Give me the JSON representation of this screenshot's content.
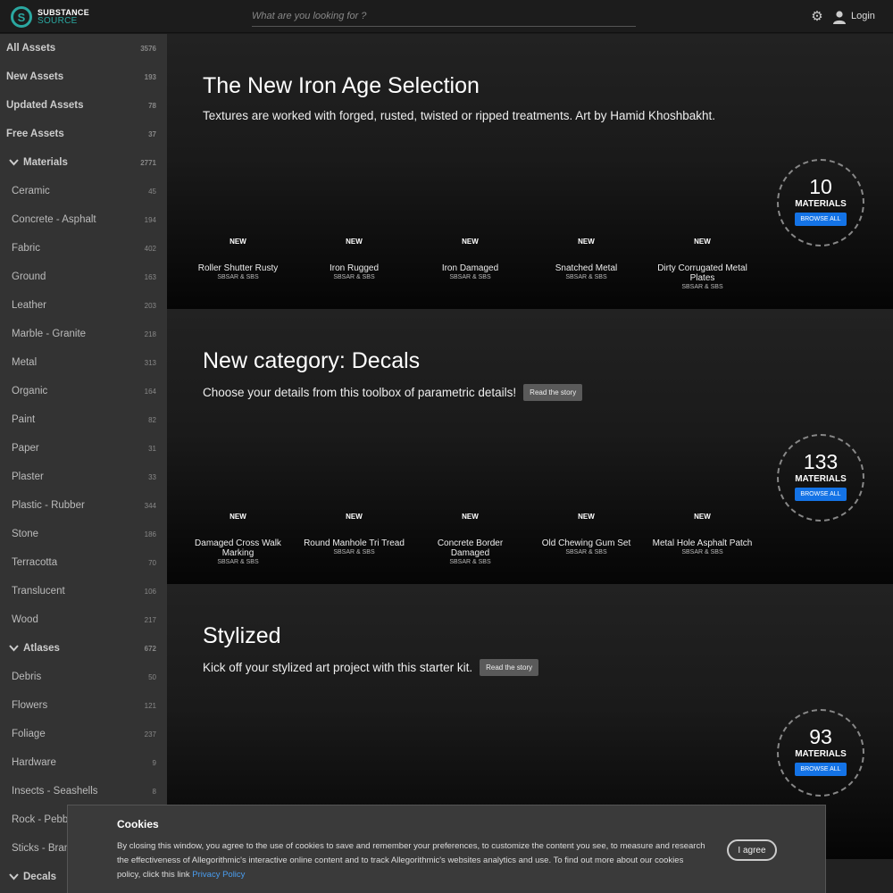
{
  "header": {
    "logo_line1": "SUBSTANCE",
    "logo_line2": "SOURCE",
    "search_placeholder": "What are you looking for ?",
    "login_label": "Login"
  },
  "sidebar": {
    "items": [
      {
        "label": "All Assets",
        "count": "3576",
        "kind": "top"
      },
      {
        "label": "New Assets",
        "count": "193",
        "kind": "top"
      },
      {
        "label": "Updated Assets",
        "count": "78",
        "kind": "top"
      },
      {
        "label": "Free Assets",
        "count": "37",
        "kind": "top"
      },
      {
        "label": "Materials",
        "count": "2771",
        "kind": "group"
      },
      {
        "label": "Ceramic",
        "count": "45",
        "kind": "sub"
      },
      {
        "label": "Concrete - Asphalt",
        "count": "194",
        "kind": "sub"
      },
      {
        "label": "Fabric",
        "count": "402",
        "kind": "sub"
      },
      {
        "label": "Ground",
        "count": "163",
        "kind": "sub"
      },
      {
        "label": "Leather",
        "count": "203",
        "kind": "sub"
      },
      {
        "label": "Marble - Granite",
        "count": "218",
        "kind": "sub"
      },
      {
        "label": "Metal",
        "count": "313",
        "kind": "sub"
      },
      {
        "label": "Organic",
        "count": "164",
        "kind": "sub"
      },
      {
        "label": "Paint",
        "count": "82",
        "kind": "sub"
      },
      {
        "label": "Paper",
        "count": "31",
        "kind": "sub"
      },
      {
        "label": "Plaster",
        "count": "33",
        "kind": "sub"
      },
      {
        "label": "Plastic - Rubber",
        "count": "344",
        "kind": "sub"
      },
      {
        "label": "Stone",
        "count": "186",
        "kind": "sub"
      },
      {
        "label": "Terracotta",
        "count": "70",
        "kind": "sub"
      },
      {
        "label": "Translucent",
        "count": "106",
        "kind": "sub"
      },
      {
        "label": "Wood",
        "count": "217",
        "kind": "sub"
      },
      {
        "label": "Atlases",
        "count": "672",
        "kind": "group"
      },
      {
        "label": "Debris",
        "count": "50",
        "kind": "sub"
      },
      {
        "label": "Flowers",
        "count": "121",
        "kind": "sub"
      },
      {
        "label": "Foliage",
        "count": "237",
        "kind": "sub"
      },
      {
        "label": "Hardware",
        "count": "9",
        "kind": "sub"
      },
      {
        "label": "Insects - Seashells",
        "count": "8",
        "kind": "sub"
      },
      {
        "label": "Rock - Pebbl",
        "count": "",
        "kind": "sub"
      },
      {
        "label": "Sticks - Branc",
        "count": "",
        "kind": "sub"
      },
      {
        "label": "Decals",
        "count": "",
        "kind": "group"
      }
    ]
  },
  "sections": [
    {
      "title": "The New Iron Age Selection",
      "description": "Textures are worked with forged, rusted, twisted or ripped treatments. Art by Hamid Khoshbakht.",
      "story_label": "",
      "count": "10",
      "count_label": "MATERIALS",
      "browse_label": "BROWSE ALL",
      "assets": [
        {
          "badge": "NEW",
          "name": "Roller Shutter Rusty",
          "format": "SBSAR & SBS"
        },
        {
          "badge": "NEW",
          "name": "Iron Rugged",
          "format": "SBSAR & SBS"
        },
        {
          "badge": "NEW",
          "name": "Iron Damaged",
          "format": "SBSAR & SBS"
        },
        {
          "badge": "NEW",
          "name": "Snatched Metal",
          "format": "SBSAR & SBS"
        },
        {
          "badge": "NEW",
          "name": "Dirty Corrugated Metal Plates",
          "format": "SBSAR & SBS"
        }
      ]
    },
    {
      "title": "New category: Decals",
      "description": "Choose your details from this toolbox of parametric details!",
      "story_label": "Read the story",
      "count": "133",
      "count_label": "MATERIALS",
      "browse_label": "BROWSE ALL",
      "assets": [
        {
          "badge": "NEW",
          "name": "Damaged Cross Walk Marking",
          "format": "SBSAR & SBS"
        },
        {
          "badge": "NEW",
          "name": "Round Manhole Tri Tread",
          "format": "SBSAR & SBS"
        },
        {
          "badge": "NEW",
          "name": "Concrete Border Damaged",
          "format": "SBSAR & SBS"
        },
        {
          "badge": "NEW",
          "name": "Old Chewing Gum Set",
          "format": "SBSAR & SBS"
        },
        {
          "badge": "NEW",
          "name": "Metal Hole Asphalt Patch",
          "format": "SBSAR & SBS"
        }
      ]
    },
    {
      "title": "Stylized",
      "description": "Kick off your stylized art project with this starter kit.",
      "story_label": "Read the story",
      "count": "93",
      "count_label": "MATERIALS",
      "browse_label": "BROWSE ALL",
      "assets": []
    }
  ],
  "cookie": {
    "title": "Cookies",
    "text": "By closing this window, you agree to the use of cookies to save and remember your preferences, to customize the content you see, to measure and research the effectiveness of Allegorithmic's interactive online content and to track Allegorithmic's websites analytics and use. To find out more about our cookies policy, click this link ",
    "link_label": "Privacy Policy",
    "agree_label": "I agree"
  },
  "colors": {
    "accent": "#2aa7a0",
    "button_blue": "#1473e6"
  }
}
